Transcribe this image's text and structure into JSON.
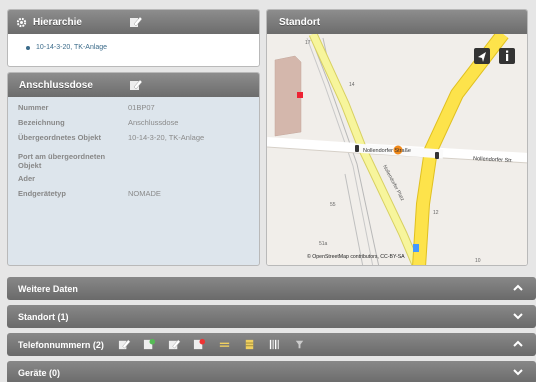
{
  "hierarchy": {
    "title": "Hierarchie",
    "item": "10-14-3-20, TK-Anlage"
  },
  "socket": {
    "title": "Anschlussdose",
    "fields": [
      {
        "label": "Nummer",
        "value": "01BP07"
      },
      {
        "label": "Bezeichnung",
        "value": "Anschlussdose"
      },
      {
        "label": "Übergeordnetes Objekt",
        "value": "10-14-3-20, TK-Anlage"
      },
      {
        "label": "Port am übergeordneten Objekt",
        "value": ""
      },
      {
        "label": "Ader",
        "value": ""
      },
      {
        "label": "Endgerätetyp",
        "value": "NOMADE"
      }
    ]
  },
  "location": {
    "title": "Standort",
    "map": {
      "streets": [
        "Nollendorfer Straße",
        "Nollendorfer Str.",
        "Nollendorfer Platz"
      ],
      "numbers": [
        "17",
        "14",
        "55",
        "12",
        "51a",
        "10"
      ],
      "attribution": "© OpenStreetMap contributors, CC-BY-SA"
    }
  },
  "sections": [
    {
      "label": "Weitere Daten",
      "state": "expanded"
    },
    {
      "label": "Standort (1)",
      "state": "collapsed"
    },
    {
      "label": "Telefonnummern (2)",
      "state": "expanded"
    },
    {
      "label": "Geräte (0)",
      "state": "collapsed"
    }
  ],
  "icons": {
    "edit": "edit-icon",
    "locate": "locate-arrow-icon",
    "info": "info-icon",
    "gear": "gear-icon"
  }
}
